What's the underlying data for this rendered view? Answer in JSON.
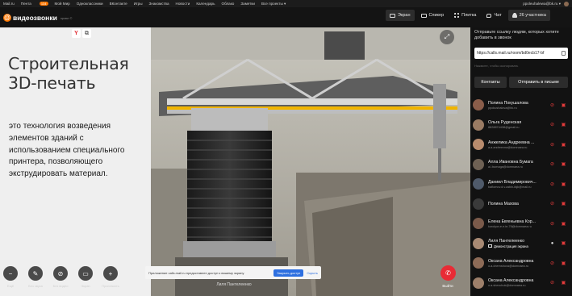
{
  "topnav": {
    "items": [
      "Mail.ru",
      "Пента",
      "Мой Мир",
      "Одноклассники",
      "ВКонтакте",
      "Игры",
      "Знакомства",
      "Новости",
      "Календарь",
      "Облако",
      "Заметки",
      "Все проекты ▾"
    ],
    "badge": "134",
    "user": "ppoleuhalewa@bk.ru ▾"
  },
  "header": {
    "logo_text": "видеозвонки",
    "logo_sub": "проект ©",
    "views": [
      {
        "label": "Экран",
        "icon": "screen-icon",
        "active": true
      },
      {
        "label": "Спикер",
        "icon": "speaker-icon",
        "active": false
      },
      {
        "label": "Плитка",
        "icon": "grid-icon",
        "active": false
      },
      {
        "label": "Чат",
        "icon": "chat-icon",
        "active": false
      },
      {
        "label": "26 участника",
        "icon": "people-icon",
        "active": true
      }
    ]
  },
  "slide": {
    "title": "Строительная 3D-печать",
    "body": "это технология возведения элементов зданий с использованием специального принтера, позволяющего экструдировать материал."
  },
  "stage": {
    "speaker_name": "Лиля Пантелеенко",
    "controls": [
      {
        "label": "Ещё",
        "icon": "more-icon"
      },
      {
        "label": "Без звука",
        "icon": "mic-off-icon"
      },
      {
        "label": "Без видео",
        "icon": "camera-off-icon"
      },
      {
        "label": "Экран",
        "icon": "screen-share-icon"
      },
      {
        "label": "Пригласить",
        "icon": "add-icon"
      }
    ],
    "hangup_label": "Выйти",
    "notice": {
      "text": "Приложение calls.mail.ru предоставлен доступ к вашему экрану",
      "allow_label": "Закрыть доступ",
      "hide_label": "Скрыть"
    }
  },
  "sidebar": {
    "intro": "Отправьте ссылку людям, которых хотите добавить в звонок",
    "link": "https://calls.mail.ru/room/bd0ecb17-bf",
    "hint": "Нажмите, чтобы скопировать",
    "contacts_label": "Контакты",
    "send_mail_label": "Отправить в письме",
    "participants": [
      {
        "name": "Полина Покушалова",
        "email": "ppokushalova@bk.ru",
        "mic": "off",
        "cam": "off",
        "avatar_color": "#8a5d4a"
      },
      {
        "name": "Ольга Руденская",
        "email": "8828874438@gmail.ru",
        "mic": "off",
        "cam": "off",
        "avatar_color": "#9a7b63"
      },
      {
        "name": "Анжелика Андреевна ...",
        "email": "a.a.andreevna@domnaea.ru",
        "mic": "off",
        "cam": "off",
        "avatar_color": "#b88b6d"
      },
      {
        "name": "Алла Ивановна Бумага",
        "email": "a.i.bumaga@domnaea.ru",
        "mic": "off",
        "cam": "off",
        "avatar_color": "#6e6154"
      },
      {
        "name": "Даниил Владимирович...",
        "email": "baflomov.d.v.zabin-fajk@mail.ru",
        "mic": "off",
        "cam": "off",
        "avatar_color": "#4f5a6a"
      },
      {
        "name": "Полина Махова",
        "email": "",
        "mic": "off",
        "cam": "off",
        "avatar_color": "#3a3a3a"
      },
      {
        "name": "Елена Евгеньевна Кор...",
        "email": "korolyov.e.e.ie-76@domnaea.ru",
        "mic": "off",
        "cam": "off",
        "avatar_color": "#7a5a4a"
      },
      {
        "name": "Лиля Пантелеенко",
        "email": "",
        "sub": "Демонстрация экрана",
        "mic": "on",
        "cam": "off",
        "avatar_color": "#a88a74"
      },
      {
        "name": "Оксана Александровна",
        "email": "o.a.chernshova@domnaea.ru",
        "mic": "off",
        "cam": "off",
        "avatar_color": "#8d6b57"
      },
      {
        "name": "Оксана Александровна",
        "email": "o.a.shevchuk@domnaea.ru",
        "mic": "off",
        "cam": "off",
        "avatar_color": "#9d7f6a"
      }
    ]
  }
}
